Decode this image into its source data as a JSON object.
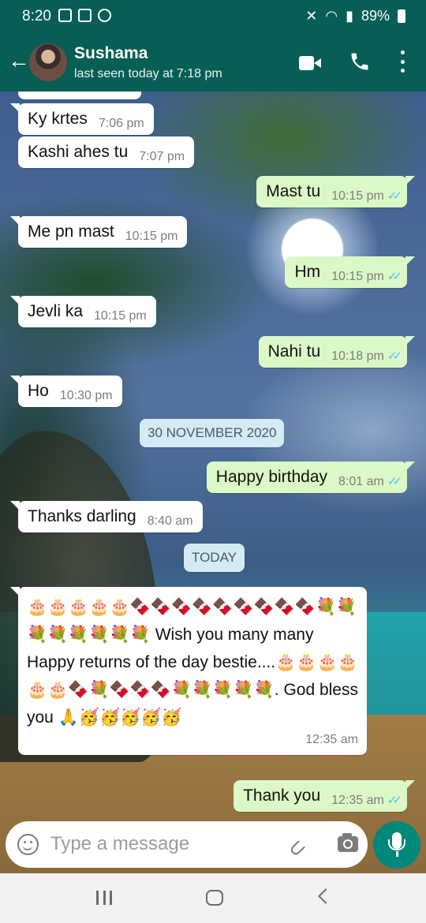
{
  "status_bar": {
    "time": "8:20",
    "battery": "89%"
  },
  "header": {
    "contact_name": "Sushama",
    "last_seen": "last seen today at 7:18 pm"
  },
  "messages": [
    {
      "dir": "in",
      "text": "Ky krtes",
      "time": "7:06 pm"
    },
    {
      "dir": "in",
      "text": "Kashi ahes tu",
      "time": "7:07 pm"
    },
    {
      "dir": "out",
      "text": "Mast tu",
      "time": "10:15 pm",
      "ticks": "✓✓"
    },
    {
      "dir": "in",
      "text": "Me pn mast",
      "time": "10:15 pm"
    },
    {
      "dir": "out",
      "text": "Hm",
      "time": "10:15 pm",
      "ticks": "✓✓"
    },
    {
      "dir": "in",
      "text": "Jevli ka",
      "time": "10:15 pm"
    },
    {
      "dir": "out",
      "text": "Nahi tu",
      "time": "10:18 pm",
      "ticks": "✓✓"
    },
    {
      "dir": "in",
      "text": "Ho",
      "time": "10:30 pm"
    },
    {
      "dir": "out",
      "text": "Happy birthday",
      "time": "8:01 am",
      "ticks": "✓✓"
    },
    {
      "dir": "in",
      "text": "Thanks darling",
      "time": "8:40 am"
    },
    {
      "dir": "in",
      "text": "🎂🎂🎂🎂🎂🍫🍫🍫🍫🍫🍫🍫🍫🍫💐💐💐💐💐💐💐💐 Wish you many many Happy returns of the day bestie....🎂🎂🎂🎂🎂🎂🍫💐🍫🍫🍫💐💐💐💐💐. God bless you 🙏🥳🥳🥳🥳🥳",
      "time": "12:35 am"
    },
    {
      "dir": "out",
      "text": "Thank you",
      "time": "12:35 am",
      "ticks": "✓✓"
    }
  ],
  "date_chips": [
    "30 NOVEMBER 2020",
    "TODAY"
  ],
  "input": {
    "placeholder": "Type a message"
  },
  "icons": {
    "back": "back-arrow-icon",
    "video": "video-call-icon",
    "voice": "voice-call-icon",
    "menu": "more-options-icon",
    "emoji": "emoji-icon",
    "attach": "attach-icon",
    "camera": "camera-icon",
    "mic": "mic-icon"
  },
  "colors": {
    "header": "#075e54",
    "outgoing_bubble": "#dcf8c6",
    "incoming_bubble": "#ffffff",
    "read_ticks": "#4fc3f7",
    "mic_button": "#00897b",
    "date_chip": "#d4eaf4"
  }
}
